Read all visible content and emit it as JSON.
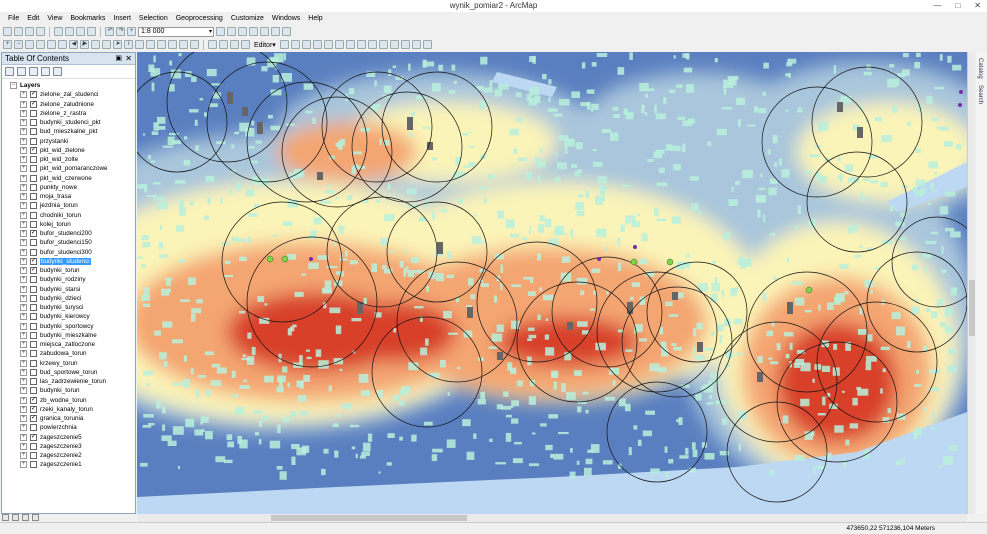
{
  "window": {
    "title": "wynik_pomiar2 - ArcMap"
  },
  "menu": [
    "File",
    "Edit",
    "View",
    "Bookmarks",
    "Insert",
    "Selection",
    "Geoprocessing",
    "Customize",
    "Windows",
    "Help"
  ],
  "toolbar": {
    "scale_value": "1:8 000",
    "editor_label": "Editor▾"
  },
  "toc": {
    "title": "Table Of Contents",
    "root_label": "Layers",
    "layers": [
      {
        "name": "zielone_zal_studenci",
        "checked": true
      },
      {
        "name": "zielone_zaludnione",
        "checked": true
      },
      {
        "name": "zielone_z_rastra",
        "checked": false
      },
      {
        "name": "budynki_studenci_pkt",
        "checked": false
      },
      {
        "name": "bud_mieszkalne_pkt",
        "checked": false
      },
      {
        "name": "przystanki",
        "checked": false
      },
      {
        "name": "pkt_wid_zielone",
        "checked": true
      },
      {
        "name": "pkt_wid_zolte",
        "checked": false
      },
      {
        "name": "pkt_wid_pomaranczowe",
        "checked": false
      },
      {
        "name": "pkt_wid_czerwone",
        "checked": false
      },
      {
        "name": "punkty_nowe",
        "checked": false
      },
      {
        "name": "moja_trasa",
        "checked": false
      },
      {
        "name": "jezdnia_torun",
        "checked": false
      },
      {
        "name": "chodniki_torun",
        "checked": false
      },
      {
        "name": "kolej_torun",
        "checked": false
      },
      {
        "name": "bufor_studenci200",
        "checked": true
      },
      {
        "name": "bufor_studenci150",
        "checked": false
      },
      {
        "name": "bufor_studenci300",
        "checked": false
      },
      {
        "name": "budynki_studenci",
        "checked": true,
        "selected": true
      },
      {
        "name": "budynki_torun",
        "checked": true
      },
      {
        "name": "budynki_rodziny",
        "checked": false
      },
      {
        "name": "budynki_starsi",
        "checked": false
      },
      {
        "name": "budynki_dzieci",
        "checked": false
      },
      {
        "name": "budynki_turysci",
        "checked": false
      },
      {
        "name": "budynki_kierowcy",
        "checked": false
      },
      {
        "name": "budynki_sportowcy",
        "checked": false
      },
      {
        "name": "budynki_mieszkalne",
        "checked": false
      },
      {
        "name": "miejsca_zatloczone",
        "checked": false
      },
      {
        "name": "zabudowa_torun",
        "checked": false
      },
      {
        "name": "krzewy_torun",
        "checked": false
      },
      {
        "name": "bud_sportowe_torun",
        "checked": false
      },
      {
        "name": "las_zadrzewienie_torun",
        "checked": false
      },
      {
        "name": "budynki_torun",
        "checked": false
      },
      {
        "name": "zb_wodne_torun",
        "checked": true
      },
      {
        "name": "rzeki_kanaly_torun",
        "checked": true
      },
      {
        "name": "granica_torunia",
        "checked": true
      },
      {
        "name": "powierzchnia",
        "checked": false
      },
      {
        "name": "zageszczenie5",
        "checked": true
      },
      {
        "name": "zageszczenie3",
        "checked": false
      },
      {
        "name": "zageszczenie2",
        "checked": false
      },
      {
        "name": "zageszczenie1",
        "checked": false
      }
    ]
  },
  "side_tabs": [
    "Catalog",
    "Search"
  ],
  "status": {
    "coordinates": "473650,22  571236,104 Meters"
  },
  "colors": {
    "density_low": "#5a7fc0",
    "density_mid": "#a9c6dc",
    "density_pale": "#fbf4b8",
    "density_orange": "#f4a672",
    "density_high": "#d8412a",
    "water": "#bcd8f2",
    "buildings": "#b8f0dc",
    "student_buildings": "#666666",
    "green_points": "#7fd44c",
    "purple_points": "#7b2aa6"
  }
}
